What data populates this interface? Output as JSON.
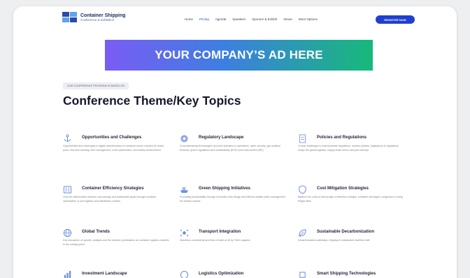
{
  "header": {
    "logo_title": "Container Shipping",
    "logo_subtitle": "Conference & Exhibition",
    "nav": [
      "Home",
      "Pricing",
      "Agenda",
      "Speakers",
      "Sponsor & Exhibit",
      "Venue",
      "More Options"
    ],
    "nav_active_index": 1,
    "cta_label": "REGISTER NOW"
  },
  "ad": {
    "text": "YOUR COMPANY’S AD HERE",
    "gradient": [
      "#7a5cf4",
      "#3d7fe0",
      "#17b97a"
    ]
  },
  "section": {
    "badge": "OUR CONFERENCE PROGRAM IS BASED ON",
    "title": "Conference Theme/Key Topics"
  },
  "topics": [
    {
      "icon": "anchor-icon",
      "title": "Opportunities and Challenges",
      "desc": "Opportunities and challenges in digital transformation in container sector industry for smart ports, real-time tracking, fleet management, route optimization, and safety enhancement"
    },
    {
      "icon": "gear-icon",
      "title": "Regulatory Landscape",
      "desc": "Groundbreaking technologies and best practices in operations, cyber security, geo-political tensions, green regulations and sustainability (ESG) and environment (IEE)"
    },
    {
      "icon": "document-icon",
      "title": "Policies and Regulations",
      "desc": "Crucial challenges & environmental regulations, modern policies, legislations & regulations shape the global logistics, supply chain forms, and port industry"
    },
    {
      "icon": "container-icon",
      "title": "Container Efficiency Strategies",
      "desc": "How the stakeholders achieve cost savings and sustainable goals through container optimization in port logistics and distribution centers"
    },
    {
      "icon": "ship-icon",
      "title": "Green Shipping Initiatives",
      "desc": "Promoting sustainability through innovative ship design and efficient ballast water management for cleaner oceans"
    },
    {
      "icon": "shield-icon",
      "title": "Cost Mitigation Strategies",
      "desc": "Balance the costs of demurrage & detention charges, container shortages, congestion & rising freight rates"
    },
    {
      "icon": "globe-icon",
      "title": "Global Trends",
      "desc": "Key discussion on growth, analysis and the decisive prioritization on container logistics markets in the coming years"
    },
    {
      "icon": "network-icon",
      "title": "Transport Integration",
      "desc": "Seamless connectivity and flow of trade at all by Third Logistics"
    },
    {
      "icon": "leaf-icon",
      "title": "Sustainable Decarbonization",
      "desc": "Decarbonization pathways, shipping & sustainable maritime shift"
    },
    {
      "icon": "chart-icon",
      "title": "Investment Landscape",
      "desc": ""
    },
    {
      "icon": "route-icon",
      "title": "Logistics Optimization",
      "desc": ""
    },
    {
      "icon": "chip-icon",
      "title": "Smart Shipping Technologies",
      "desc": ""
    }
  ]
}
